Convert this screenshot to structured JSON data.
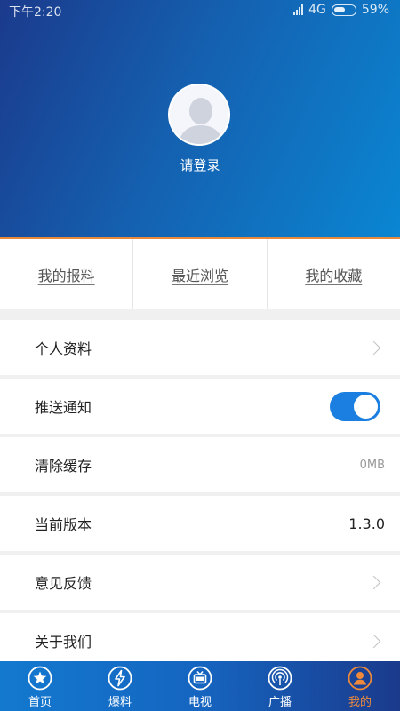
{
  "status_bar": {
    "time": "下午2:20",
    "network": "4G",
    "battery": "59%"
  },
  "profile": {
    "login_text": "请登录"
  },
  "tabs": [
    {
      "label": "我的报料"
    },
    {
      "label": "最近浏览"
    },
    {
      "label": "我的收藏"
    }
  ],
  "settings": {
    "profile": {
      "label": "个人资料"
    },
    "push": {
      "label": "推送通知",
      "enabled": true
    },
    "cache": {
      "label": "清除缓存",
      "value": "0MB"
    },
    "version": {
      "label": "当前版本",
      "value": "1.3.0"
    },
    "feedback": {
      "label": "意见反馈"
    },
    "about": {
      "label": "关于我们"
    }
  },
  "bottom_nav": [
    {
      "label": "首页",
      "icon": "star-icon",
      "active": false
    },
    {
      "label": "爆料",
      "icon": "lightning-icon",
      "active": false
    },
    {
      "label": "电视",
      "icon": "tv-icon",
      "active": false
    },
    {
      "label": "广播",
      "icon": "broadcast-icon",
      "active": false
    },
    {
      "label": "我的",
      "icon": "person-icon",
      "active": true
    }
  ],
  "colors": {
    "accent": "#1a7fe0",
    "active_nav": "#f08a3a",
    "header_from": "#1b3a8c",
    "header_to": "#0a86d2"
  }
}
